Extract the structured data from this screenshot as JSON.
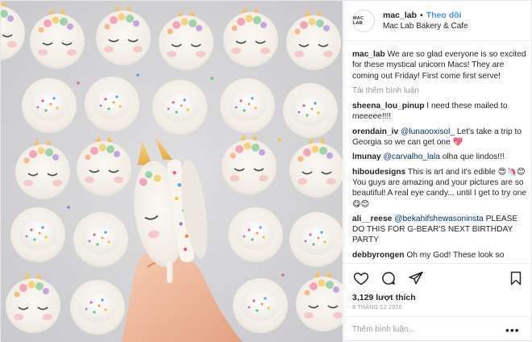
{
  "post": {
    "username": "mac_lab",
    "follow_label": "Theo dõi",
    "location": "Mac Lab Bakery & Cafe",
    "avatar_text": "MAC LAB",
    "caption": "We are so glad everyone is so excited for these mystical unicorn Macs! They are coming out Friday! First come first serve!",
    "load_more": "Tải thêm bình luận",
    "comments": [
      {
        "user": "sheena_lou_pinup",
        "text": "I need these mailed to meeeee!!!!"
      },
      {
        "user": "orendain_iv",
        "mention": "@lunaooxisol_",
        "text": "Let's take a trip to Georgia so we can get one 💖"
      },
      {
        "user": "lmunay",
        "mention": "@carvalho_lala",
        "text": "olha que lindos!!!"
      },
      {
        "user": "hiboudesigns",
        "text": "This is art and it's edible 😍🦄😊You guys are amazing and your pictures are so beautiful! A real eye candy... until I get to try one 😋😊"
      },
      {
        "user": "ali__reese",
        "mention": "@bekahifshewasoninsta",
        "text": "PLEASE DO THIS FOR G-BEAR'S NEXT BIRTHDAY PARTY"
      },
      {
        "user": "debbyrongen",
        "text": "Oh my God! These look so"
      }
    ],
    "likes": "3,129 lượt thích",
    "date": "8 THÁNG 12 2016",
    "add_comment_placeholder": "Thêm bình luận...",
    "more_label": "•••",
    "icons": {
      "like": "heart-icon",
      "comment": "comment-icon",
      "share": "share-icon",
      "save": "bookmark-icon",
      "more": "more-options-icon"
    },
    "colors": {
      "link_blue": "#3897f0",
      "text": "#262626",
      "muted": "#999999",
      "border": "#efefef"
    }
  }
}
